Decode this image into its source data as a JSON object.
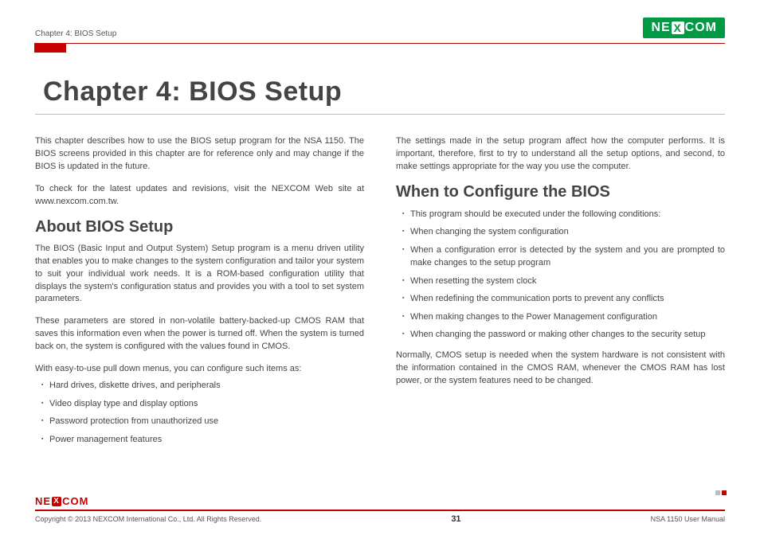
{
  "header": {
    "chapter_label": "Chapter 4: BIOS Setup",
    "brand_pre": "NE",
    "brand_x": "X",
    "brand_post": "COM"
  },
  "title": "Chapter 4: BIOS Setup",
  "left": {
    "intro_p1": "This chapter describes how to use the BIOS setup program for the NSA 1150. The BIOS screens provided in this chapter are for reference only and may change if the BIOS is updated in the future.",
    "intro_p2": "To check for the latest updates and revisions, visit the NEXCOM Web site at www.nexcom.com.tw.",
    "about_heading": "About BIOS Setup",
    "about_p1": "The BIOS (Basic Input and Output System) Setup program is a menu driven utility that enables you to make changes to the system configuration and tailor your system to suit your individual work needs. It is a ROM-based configuration utility that displays the system's configuration status and provides you with a tool to set system parameters.",
    "about_p2": "These parameters are stored in non-volatile battery-backed-up CMOS RAM that saves this information even when the power is turned off. When the system is turned back on, the system is configured with the values found in CMOS.",
    "about_p3": "With easy-to-use pull down menus, you can configure such items as:",
    "items": [
      "Hard drives, diskette drives, and peripherals",
      "Video display type and display options",
      "Password protection from unauthorized use",
      "Power management features"
    ]
  },
  "right": {
    "top_p": "The settings made in the setup program affect how the computer performs. It is important, therefore, first to try to understand all the setup options, and second, to make settings appropriate for the way you use the computer.",
    "when_heading": "When to Configure the BIOS",
    "items": [
      "This program should be executed under the following conditions:",
      "When changing the system configuration",
      "When a configuration error is detected by the system and you are prompted to make changes to the setup program",
      "When resetting the system clock",
      "When redefining the communication ports to prevent any conflicts",
      "When making changes to the Power Management configuration",
      "When changing the password or making other changes to the security setup"
    ],
    "closing_p": "Normally, CMOS setup is needed when the system hardware is not consistent with the information contained in the CMOS RAM, whenever the CMOS RAM has lost power, or the system features need to be changed."
  },
  "footer": {
    "brand_pre": "NE",
    "brand_x": "X",
    "brand_post": "COM",
    "copyright": "Copyright © 2013 NEXCOM International Co., Ltd. All Rights Reserved.",
    "page_num": "31",
    "doc_title": "NSA 1150 User Manual"
  }
}
